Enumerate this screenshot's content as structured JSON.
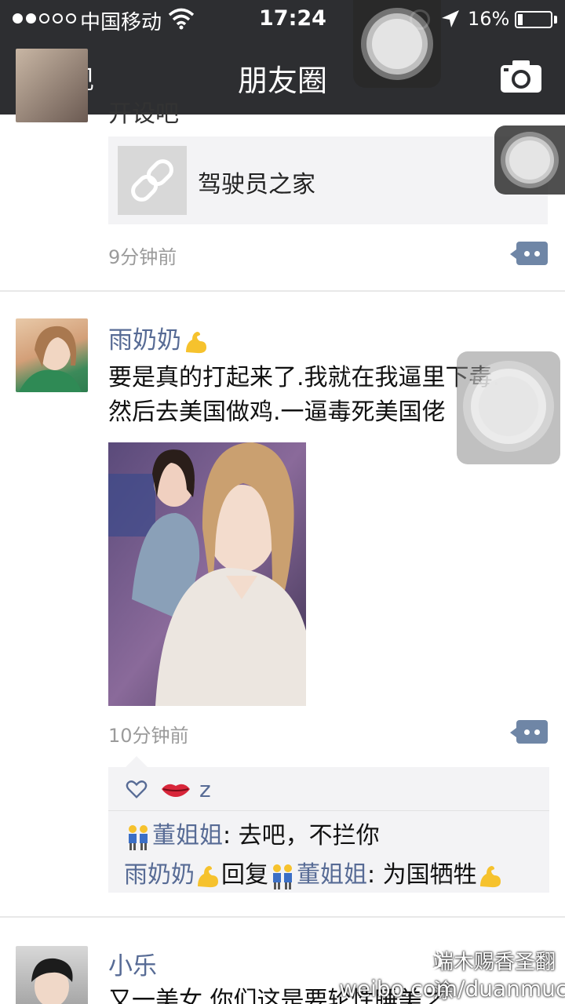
{
  "status_bar": {
    "carrier": "中国移动",
    "time": "17:24",
    "battery_percent": "16%",
    "battery_level": 0.16,
    "signal_bars_on": 2,
    "signal_bars_total": 5
  },
  "nav": {
    "back_label": "发现",
    "title": "朋友圈"
  },
  "posts": [
    {
      "partial_text": "开设吧",
      "link_title": "驾驶员之家",
      "time": "9分钟前"
    },
    {
      "name": "雨奶奶",
      "text_line1": "要是真的打起来了.我就在我逼里下毒.",
      "text_line2": "然后去美国做鸡.一逼毒死美国佬",
      "time": "10分钟前",
      "likes": "z",
      "comments": [
        {
          "author": "董姐姐",
          "sep": ": ",
          "text": "去吧，不拦你"
        },
        {
          "author": "雨奶奶",
          "reply_word": "回复",
          "reply_to": "董姐姐",
          "sep": ": ",
          "text": "为国牺牲"
        }
      ]
    },
    {
      "name": "小乐",
      "text_partial": "又一美女  你们这是要轮性睡美之"
    }
  ],
  "watermark": {
    "line1": "端木赐香圣翻涂",
    "line2": "weibo.com/duanmucixiang"
  },
  "colors": {
    "nav_bg": "#2d2e31",
    "name_blue": "#576b95",
    "card_bg": "#f3f3f5"
  }
}
